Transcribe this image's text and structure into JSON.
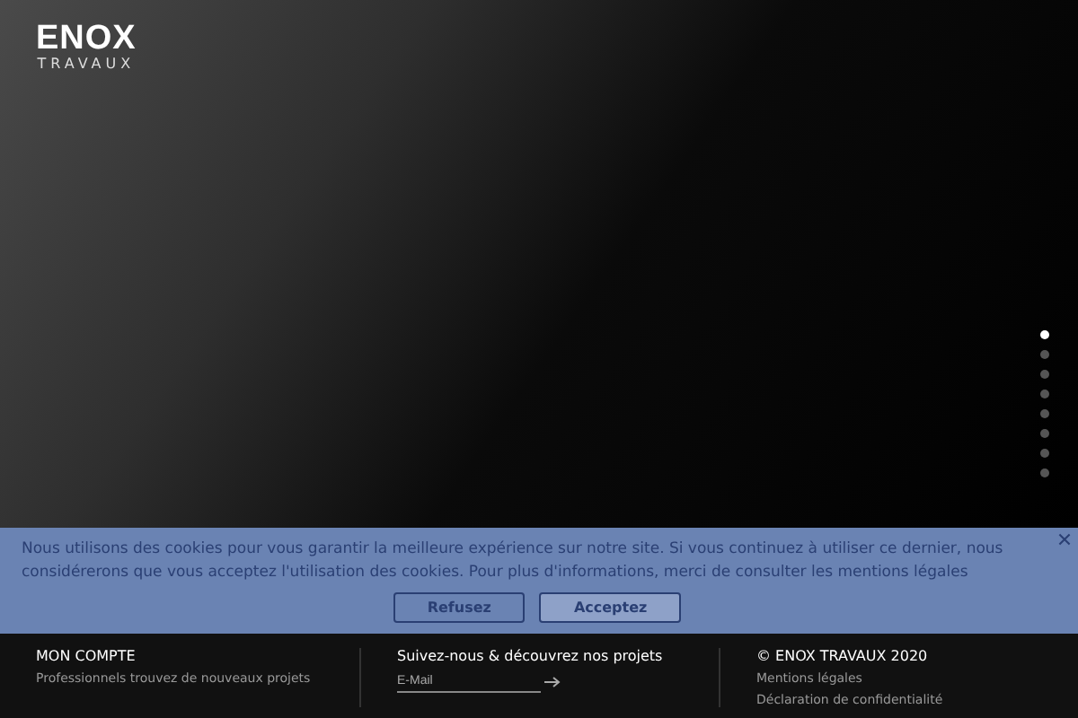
{
  "logo": {
    "name": "ENOX",
    "subtitle": "TRAVAUX"
  },
  "slider_dots": [
    {
      "selected": true
    },
    {
      "selected": false
    },
    {
      "selected": false
    },
    {
      "selected": false
    },
    {
      "selected": false
    },
    {
      "selected": false
    },
    {
      "selected": false
    },
    {
      "selected": false
    }
  ],
  "cookie_banner": {
    "text": "Nous utilisons des cookies pour vous garantir la meilleure expérience sur notre site. Si vous continuez à utiliser ce dernier, nous considérerons que vous acceptez l'utilisation des cookies. Pour plus d'informations, merci de consulter les",
    "link": "mentions légales",
    "buttons": [
      "Refusez",
      "Acceptez"
    ]
  },
  "footer": {
    "account": {
      "title": "MON COMPTE",
      "link": "Professionnels trouvez de nouveaux projets"
    },
    "newsletter": {
      "title": "Suivez-nous & découvrez nos projets",
      "placeholder": "E-Mail"
    },
    "legal": {
      "copyright": "© ENOX TRAVAUX 2020",
      "links": [
        "Mentions légales",
        "Déclaration de confidentialité"
      ]
    }
  }
}
